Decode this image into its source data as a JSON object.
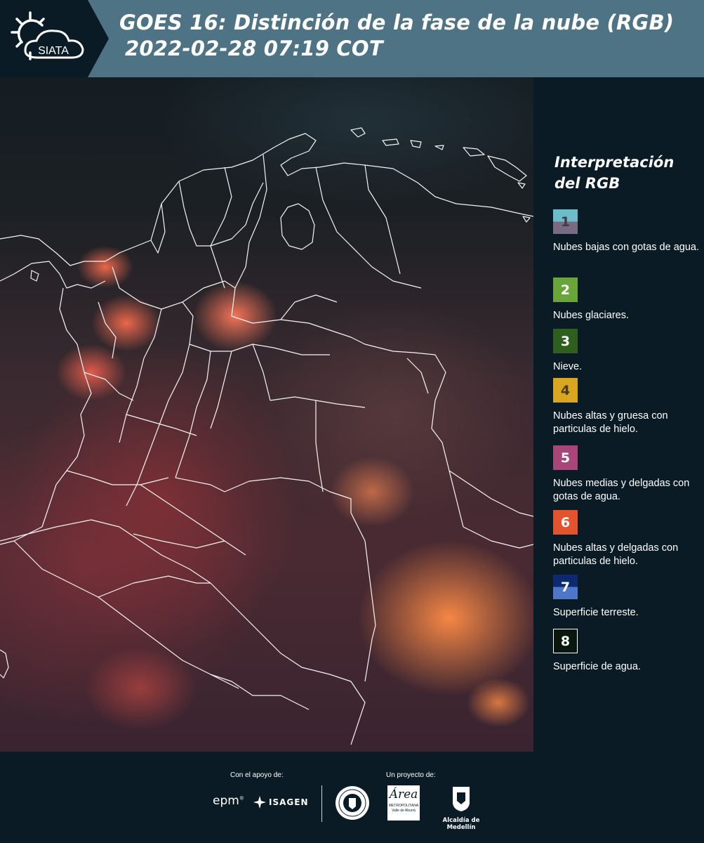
{
  "header": {
    "title_line1": "GOES 16: Distinción de la fase de la nube (RGB)",
    "title_line2": "2022-02-28 07:19 COT",
    "logo_text": "SIATA"
  },
  "legend": {
    "title_line1": "Interpretación",
    "title_line2": "del RGB",
    "items": [
      {
        "num": "1",
        "label": "Nubes bajas con gotas de agua.",
        "color_top": "#6cbcca",
        "color_bottom": "#7a6b84",
        "num_color": "#3d3d4a"
      },
      {
        "num": "2",
        "label": "Nubes glaciares.",
        "color_top": "#6aa53a",
        "color_bottom": "#6aa53a",
        "num_color": "#ffffff"
      },
      {
        "num": "3",
        "label": "Nieve.",
        "color_top": "#2f5f1e",
        "color_bottom": "#2f5f1e",
        "num_color": "#ffffff"
      },
      {
        "num": "4",
        "label": "Nubes altas y gruesa con particulas de hielo.",
        "color_top": "#d9a620",
        "color_bottom": "#d9a620",
        "num_color": "#4a3a10"
      },
      {
        "num": "5",
        "label": "Nubes medias y delgadas con gotas de agua.",
        "color_top": "#a8467a",
        "color_bottom": "#a8467a",
        "num_color": "#ffffff"
      },
      {
        "num": "6",
        "label": "Nubes altas y delgadas con particulas de hielo.",
        "color_top": "#e5522e",
        "color_bottom": "#e5522e",
        "num_color": "#ffffff"
      },
      {
        "num": "7",
        "label": "Superficie terreste.",
        "color_top": "#0e2a6e",
        "color_bottom": "#4d78c9",
        "num_color": "#ffffff"
      },
      {
        "num": "8",
        "label": "Superficie de agua.",
        "color_top": "#0a1710",
        "color_bottom": "#0a1710",
        "num_color": "#ffffff",
        "border": "#ffffff"
      }
    ]
  },
  "footer": {
    "support_label": "Con el apoyo de:",
    "project_label": "Un proyecto de:",
    "epm_text": "epm",
    "isagen_text": "ISAGEN",
    "area_text": "Área",
    "area_subtext": "METROPOLITANA",
    "area_subtext2": "Valle de Aburrá",
    "alcaldia_text": "Alcaldía de Medellín"
  }
}
